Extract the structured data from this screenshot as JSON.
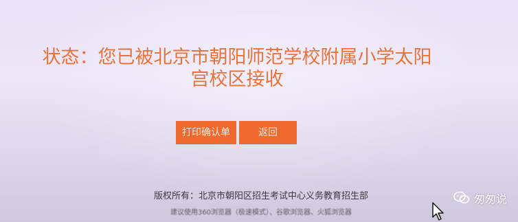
{
  "status": {
    "line1": "状态：您已被北京市朝阳师范学校附属小学太阳",
    "line2": "宫校区接收"
  },
  "buttons": {
    "print": "打印确认单",
    "back": "返回"
  },
  "footer": {
    "copyright": "版权所有：北京市朝阳区招生考试中心义务教育招生部",
    "hint": "建议使用360浏览器（极速模式）、谷歌浏览器、火狐浏览器"
  },
  "watermark": {
    "text": "匆匆说",
    "icon": "wechat-icon"
  },
  "colors": {
    "accent": "#ee6a2e",
    "status_text": "#e8733b",
    "background": "#e9e2f7"
  }
}
